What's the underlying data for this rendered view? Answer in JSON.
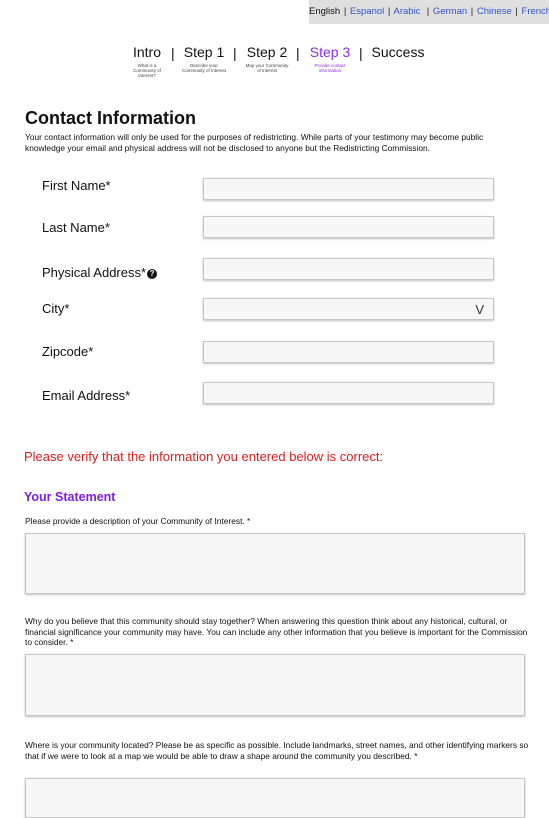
{
  "languages": {
    "current": "English",
    "options": [
      "Espanol",
      "Arabic",
      "German",
      "Chinese",
      "French"
    ]
  },
  "steps": [
    {
      "label": "Intro",
      "sub": "What is a Community of Interest?"
    },
    {
      "label": "Step 1",
      "sub": "Describe your Community of Interest"
    },
    {
      "label": "Step 2",
      "sub": "Map your Community of Interest"
    },
    {
      "label": "Step 3",
      "sub": "Provide contact information"
    },
    {
      "label": "Success",
      "sub": ""
    }
  ],
  "step_separator": "|",
  "contact": {
    "title": "Contact Information",
    "description": "Your contact information will only be used for the purposes of redistricting. While parts of your testimony may become public knowledge your email and physical address will not be disclosed to anyone but the Redistricting Commission.",
    "fields": {
      "first_name": {
        "label": "First Name*",
        "value": ""
      },
      "last_name": {
        "label": "Last Name*",
        "value": ""
      },
      "address": {
        "label": "Physical Address*",
        "value": "",
        "help": "?"
      },
      "city": {
        "label": "City*",
        "value": "",
        "caret": "V"
      },
      "zipcode": {
        "label": "Zipcode*",
        "value": ""
      },
      "email": {
        "label": "Email Address*",
        "value": ""
      }
    }
  },
  "verify_text": "Please verify that the information you entered below is correct:",
  "statement": {
    "title": "Your Statement",
    "q1": "Please provide a description of your Community of Interest.  *",
    "q2": "Why do you believe that this community should stay together? When answering this question think about any historical, cultural, or financial significance your community may have. You can include any other information that you believe is important for the Commission to consider. *",
    "q3": "Where is your community located? Please be as specific as possible. Include landmarks, street names, and other identifying markers so that if we were to look at a map we would be able to draw a shape around the community you described. *"
  },
  "colors": {
    "active_step": "#8a2be2",
    "verify": "#d42020",
    "statement_title": "#7b1fd8",
    "link": "#3355cc"
  }
}
